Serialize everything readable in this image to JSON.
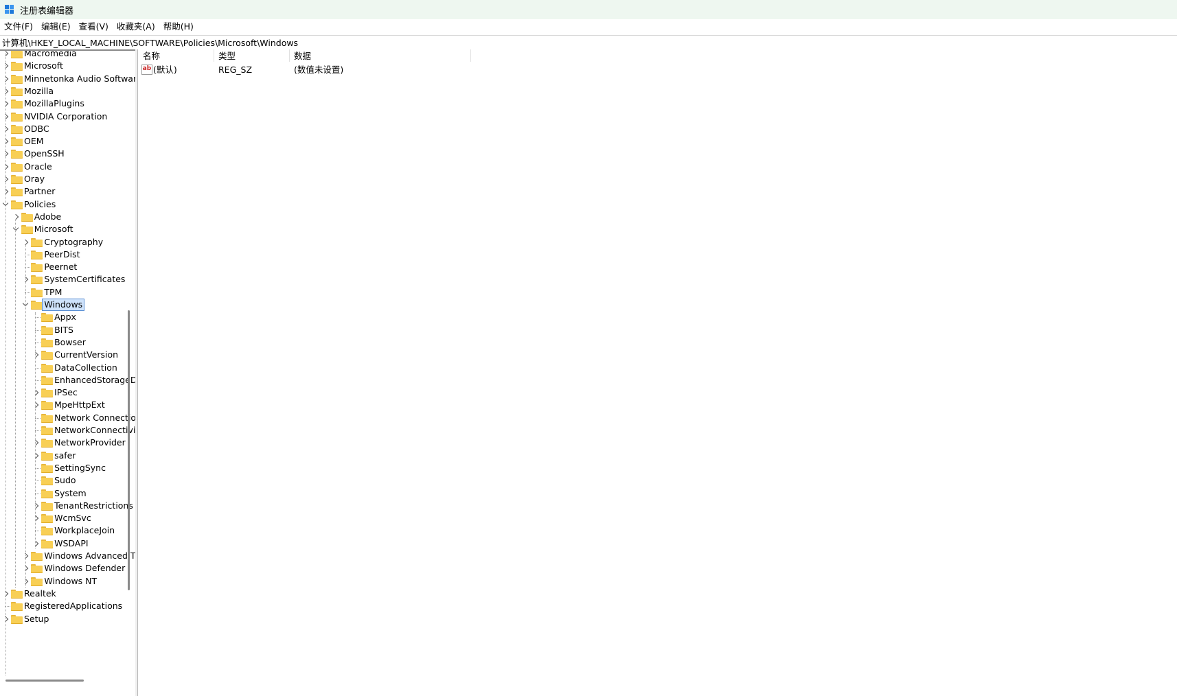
{
  "window": {
    "title": "注册表编辑器"
  },
  "menu": [
    "文件(F)",
    "编辑(E)",
    "查看(V)",
    "收藏夹(A)",
    "帮助(H)"
  ],
  "address": "计算机\\HKEY_LOCAL_MACHINE\\SOFTWARE\\Policies\\Microsoft\\Windows",
  "tree": [
    {
      "label": "Macromedia",
      "expander": "collapsed"
    },
    {
      "label": "Microsoft",
      "expander": "collapsed"
    },
    {
      "label": "Minnetonka Audio Software",
      "expander": "collapsed"
    },
    {
      "label": "Mozilla",
      "expander": "collapsed"
    },
    {
      "label": "MozillaPlugins",
      "expander": "collapsed"
    },
    {
      "label": "NVIDIA Corporation",
      "expander": "collapsed"
    },
    {
      "label": "ODBC",
      "expander": "collapsed"
    },
    {
      "label": "OEM",
      "expander": "collapsed"
    },
    {
      "label": "OpenSSH",
      "expander": "collapsed"
    },
    {
      "label": "Oracle",
      "expander": "collapsed"
    },
    {
      "label": "Oray",
      "expander": "collapsed"
    },
    {
      "label": "Partner",
      "expander": "collapsed"
    },
    {
      "label": "Policies",
      "expander": "expanded"
    },
    {
      "label": "Adobe",
      "expander": "collapsed"
    },
    {
      "label": "Microsoft",
      "expander": "expanded"
    },
    {
      "label": "Cryptography",
      "expander": "collapsed"
    },
    {
      "label": "PeerDist",
      "expander": "none"
    },
    {
      "label": "Peernet",
      "expander": "none"
    },
    {
      "label": "SystemCertificates",
      "expander": "collapsed"
    },
    {
      "label": "TPM",
      "expander": "none"
    },
    {
      "label": "Windows",
      "expander": "expanded",
      "selected": true
    },
    {
      "label": "Appx",
      "expander": "none"
    },
    {
      "label": "BITS",
      "expander": "none"
    },
    {
      "label": "Bowser",
      "expander": "none"
    },
    {
      "label": "CurrentVersion",
      "expander": "collapsed"
    },
    {
      "label": "DataCollection",
      "expander": "none"
    },
    {
      "label": "EnhancedStorageDevices",
      "expander": "none"
    },
    {
      "label": "IPSec",
      "expander": "collapsed"
    },
    {
      "label": "MpeHttpExt",
      "expander": "collapsed"
    },
    {
      "label": "Network Connections",
      "expander": "none"
    },
    {
      "label": "NetworkConnectivityStatusIndicator",
      "expander": "none"
    },
    {
      "label": "NetworkProvider",
      "expander": "collapsed"
    },
    {
      "label": "safer",
      "expander": "collapsed"
    },
    {
      "label": "SettingSync",
      "expander": "none"
    },
    {
      "label": "Sudo",
      "expander": "none"
    },
    {
      "label": "System",
      "expander": "none"
    },
    {
      "label": "TenantRestrictions",
      "expander": "collapsed"
    },
    {
      "label": "WcmSvc",
      "expander": "collapsed"
    },
    {
      "label": "WorkplaceJoin",
      "expander": "none"
    },
    {
      "label": "WSDAPI",
      "expander": "collapsed"
    },
    {
      "label": "Windows Advanced Threat Protection",
      "expander": "collapsed"
    },
    {
      "label": "Windows Defender",
      "expander": "collapsed"
    },
    {
      "label": "Windows NT",
      "expander": "collapsed"
    },
    {
      "label": "Realtek",
      "expander": "collapsed"
    },
    {
      "label": "RegisteredApplications",
      "expander": "none"
    },
    {
      "label": "Setup",
      "expander": "collapsed"
    }
  ],
  "columns": {
    "name": "名称",
    "type": "类型",
    "data": "数据"
  },
  "values": [
    {
      "name": "(默认)",
      "type": "REG_SZ",
      "data": "(数值未设置)",
      "icon": "string-value-icon"
    }
  ]
}
